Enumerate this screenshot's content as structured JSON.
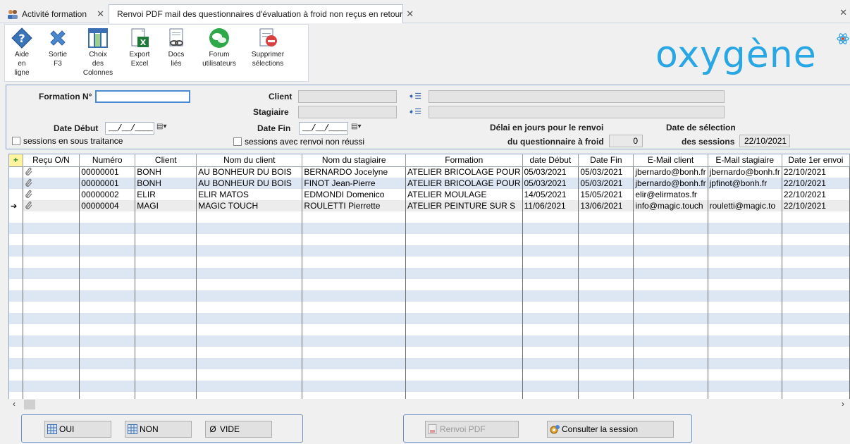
{
  "tabs": [
    {
      "label": "Activité formation",
      "icon": "users-icon"
    },
    {
      "label": "Renvoi PDF mail des questionnaires d'évaluation à froid non reçus en retour",
      "icon": "document-icon",
      "active": true
    }
  ],
  "ribbon": [
    {
      "name": "help-button",
      "label": "Aide\nen\nligne",
      "icon": "help-icon"
    },
    {
      "name": "exit-button",
      "label": "Sortie\nF3",
      "icon": "close-icon"
    },
    {
      "name": "columns-button",
      "label": "Choix\ndes\nColonnes",
      "icon": "columns-icon"
    },
    {
      "name": "export-excel-button",
      "label": "Export\nExcel",
      "icon": "excel-icon"
    },
    {
      "name": "docs-button",
      "label": "Docs\nliés",
      "icon": "linked-docs-icon"
    },
    {
      "name": "forum-button",
      "label": "Forum\nutilisateurs",
      "icon": "forum-icon"
    },
    {
      "name": "clear-selection-button",
      "label": "Supprimer\nsélections",
      "icon": "clear-selection-icon"
    }
  ],
  "logo": "oxygène",
  "filters": {
    "formation_label": "Formation N°",
    "formation_value": "",
    "client_label": "Client",
    "stagiaire_label": "Stagiaire",
    "date_debut_label": "Date Début",
    "date_debut_value": "__/__/____",
    "date_fin_label": "Date Fin",
    "date_fin_value": "__/__/____",
    "sous_traitance_label": "sessions en sous traitance",
    "renvoi_non_reussi_label": "sessions avec renvoi non réussi",
    "delai_label_1": "Délai en jours pour le renvoi",
    "delai_label_2": "du questionnaire à froid",
    "delai_value": "0",
    "selection_label_1": "Date de sélection",
    "selection_label_2": "des sessions",
    "selection_value": "22/10/2021"
  },
  "grid": {
    "columns": [
      "Reçu O/N",
      "Numéro",
      "Client",
      "Nom du client",
      "Nom du stagiaire",
      "Formation",
      "date Début",
      "Date Fin",
      "E-Mail client",
      "E-Mail stagiaire",
      "Date 1er envoi"
    ],
    "rows": [
      [
        "",
        "00000001",
        "BONH",
        "AU BONHEUR DU BOIS",
        "BERNARDO Jocelyne",
        "ATELIER BRICOLAGE POUR",
        "05/03/2021",
        "05/03/2021",
        "jbernardo@bonh.fr",
        "jbernardo@bonh.fr",
        "22/10/2021"
      ],
      [
        "",
        "00000001",
        "BONH",
        "AU BONHEUR DU BOIS",
        "FINOT Jean-Pierre",
        "ATELIER BRICOLAGE POUR",
        "05/03/2021",
        "05/03/2021",
        "jbernardo@bonh.fr",
        "jpfinot@bonh.fr",
        "22/10/2021"
      ],
      [
        "",
        "00000002",
        "ELIR",
        "ELIR MATOS",
        "EDMONDI Domenico",
        "ATELIER MOULAGE",
        "14/05/2021",
        "15/05/2021",
        "elir@elirmatos.fr",
        "",
        "22/10/2021"
      ],
      [
        "",
        "00000004",
        "MAGI",
        "MAGIC TOUCH",
        "ROULETTI Pierrette",
        "ATELIER PEINTURE SUR S",
        "11/06/2021",
        "13/06/2021",
        "info@magic.touch",
        "rouletti@magic.to",
        "22/10/2021"
      ]
    ],
    "current_row": 3
  },
  "buttons": {
    "oui": "OUI",
    "non": "NON",
    "vide": "VIDE",
    "renvoi_pdf": "Renvoi PDF",
    "consulter": "Consulter la session"
  }
}
